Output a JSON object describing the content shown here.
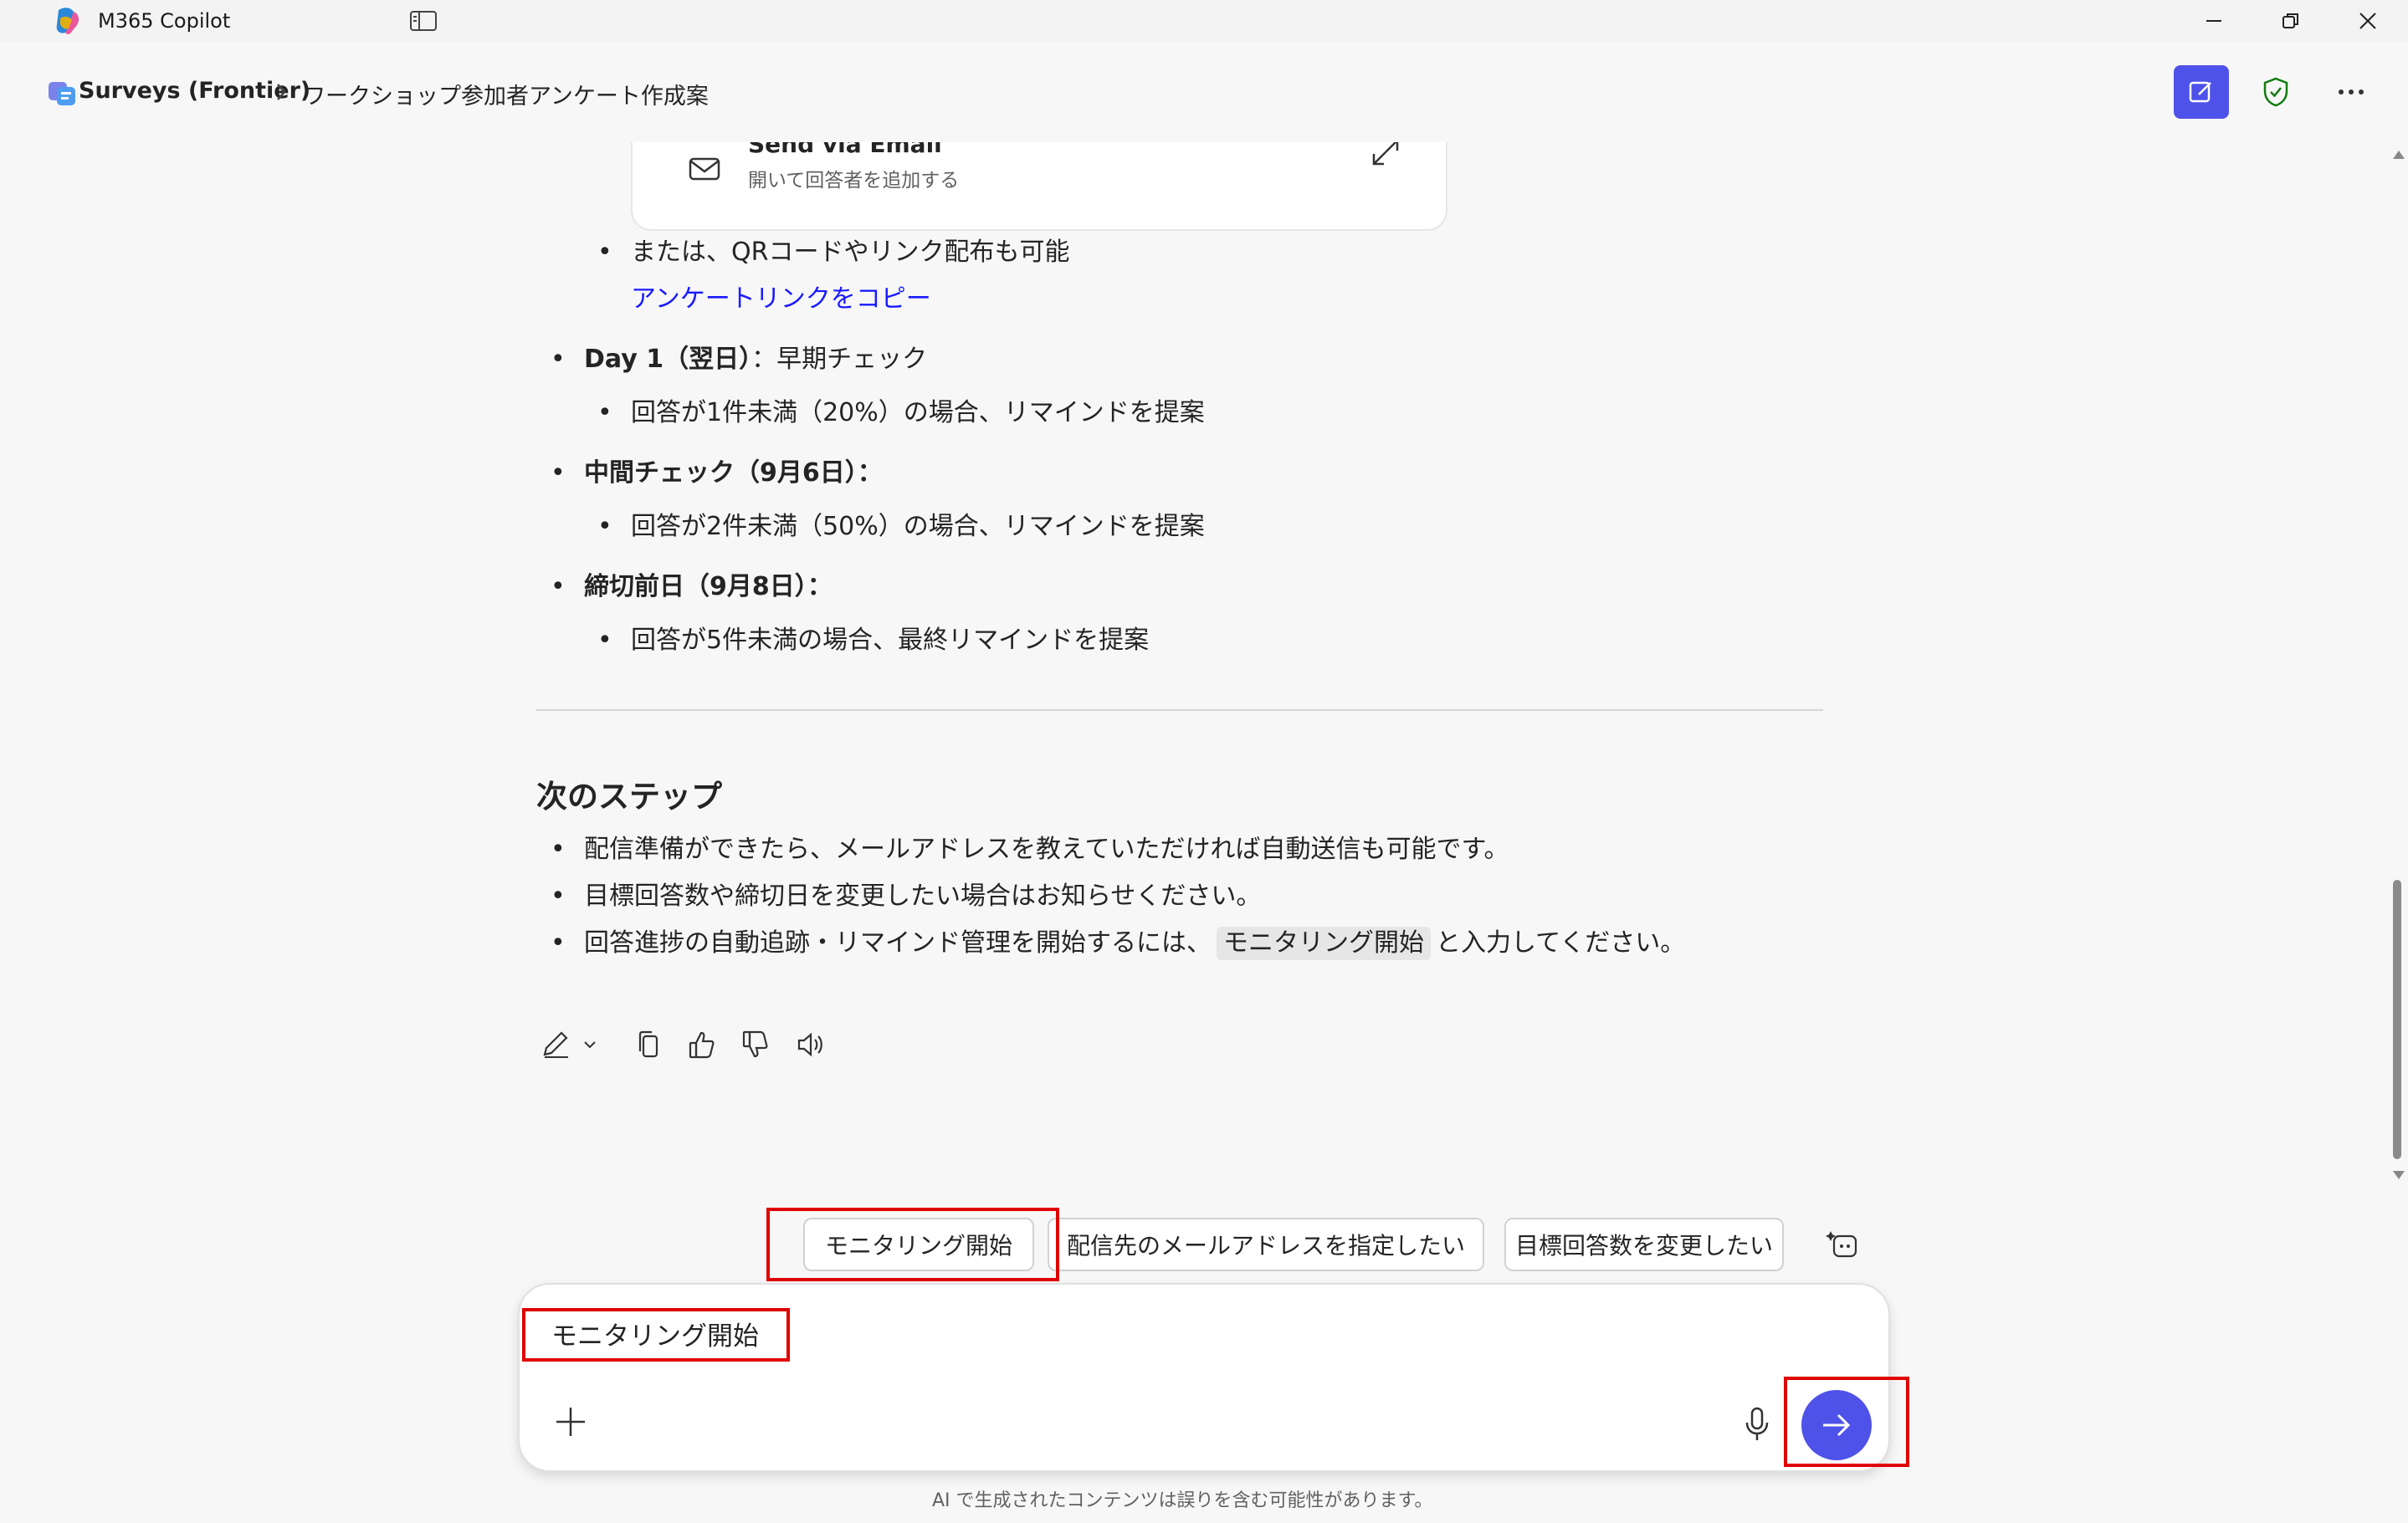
{
  "window": {
    "app_title": "M365 Copilot",
    "icons": [
      "copilot-logo",
      "sidebar-toggle-icon",
      "minimize-icon",
      "restore-icon",
      "close-icon"
    ]
  },
  "header": {
    "agent_name": "Surveys (Frontier)",
    "conversation_title": "ワークショップ参加者アンケート作成案",
    "accent_color": "#4f52e8"
  },
  "email_card": {
    "title": "Send via Email",
    "subtitle": "開いて回答者を追加する"
  },
  "message": {
    "alt_distribution": "または、QRコードやリンク配布も可能",
    "copy_link": "アンケートリンクをコピー",
    "checks": [
      {
        "label": "Day 1（翌日）",
        "suffix": "：早期チェック",
        "detail": "回答が1件未満（20%）の場合、リマインドを提案"
      },
      {
        "label": "中間チェック（9月6日）：",
        "suffix": "",
        "detail": "回答が2件未満（50%）の場合、リマインドを提案"
      },
      {
        "label": "締切前日（9月8日）：",
        "suffix": "",
        "detail": "回答が5件未満の場合、最終リマインドを提案"
      }
    ],
    "next_steps_heading": "次のステップ",
    "next_steps": [
      "配信準備ができたら、メールアドレスを教えていただければ自動送信も可能です。",
      "目標回答数や締切日を変更したい場合はお知らせください。"
    ],
    "step3_before": "回答進捗の自動追跡・リマインド管理を開始するには、",
    "step3_code": "モニタリング開始",
    "step3_after": "と入力してください。"
  },
  "suggestions": [
    "モニタリング開始",
    "配信先のメールアドレスを指定したい",
    "目標回答数を変更したい"
  ],
  "composer": {
    "text": "モニタリング開始"
  },
  "disclaimer": "AI で生成されたコンテンツは誤りを含む可能性があります。"
}
